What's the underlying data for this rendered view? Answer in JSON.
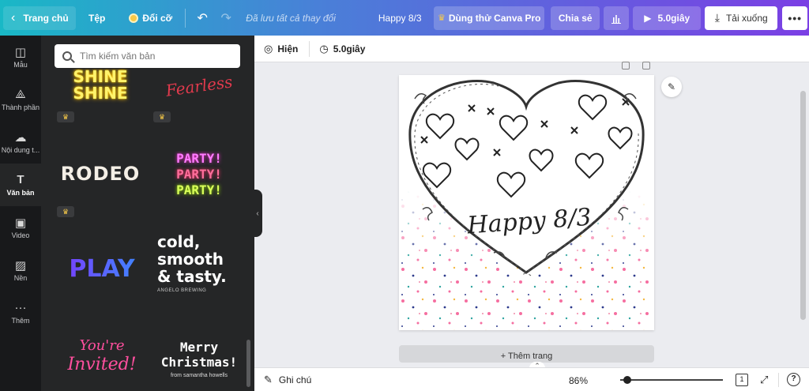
{
  "topbar": {
    "home_label": "Trang chủ",
    "file_label": "Tệp",
    "resize_label": "Đổi cỡ",
    "saved_status": "Đã lưu tất cả thay đổi",
    "doc_title": "Happy 8/3",
    "pro_label": "Dùng thử Canva Pro",
    "share_label": "Chia sẻ",
    "play_label": "5.0giây",
    "download_label": "Tải xuống"
  },
  "rail": {
    "items": [
      {
        "label": "Mẫu",
        "icon": "template-icon"
      },
      {
        "label": "Thành phần",
        "icon": "elements-icon"
      },
      {
        "label": "Nội dung t...",
        "icon": "upload-icon"
      },
      {
        "label": "Văn bản",
        "icon": "text-icon"
      },
      {
        "label": "Video",
        "icon": "video-icon"
      },
      {
        "label": "Nền",
        "icon": "background-icon"
      },
      {
        "label": "Thêm",
        "icon": "more-icon"
      }
    ]
  },
  "panel": {
    "search_placeholder": "Tìm kiếm văn bản",
    "tiles": {
      "shine_line1": "SHINE",
      "shine_line2": "SHINE",
      "fearless": "Fearless",
      "rodeo": "RODEO",
      "party1": "PARTY!",
      "party2": "PARTY!",
      "party3": "PARTY!",
      "play": "PLAY",
      "cold1": "cold,",
      "cold2": "smooth",
      "cold3": "& tasty.",
      "cold_brand": "ANGELO BREWING",
      "invited1": "You're",
      "invited2": "Invited!",
      "merry1": "Merry",
      "merry2": "Christmas!",
      "merry_by": "from samantha howells"
    }
  },
  "editor": {
    "animate_label": "Hiện",
    "duration_label": "5.0giây",
    "canvas_text": "Happy 8/3",
    "add_page_label": "+ Thêm trang"
  },
  "bottombar": {
    "notes_label": "Ghi chú",
    "zoom_label": "86%",
    "page_count": "1",
    "help_label": "?"
  },
  "colors": {
    "accent_gradient_start": "#19b8c6",
    "accent_gradient_end": "#7b3fe4",
    "panel_bg": "#252627",
    "rail_bg": "#18191b",
    "crown": "#f7c948"
  }
}
